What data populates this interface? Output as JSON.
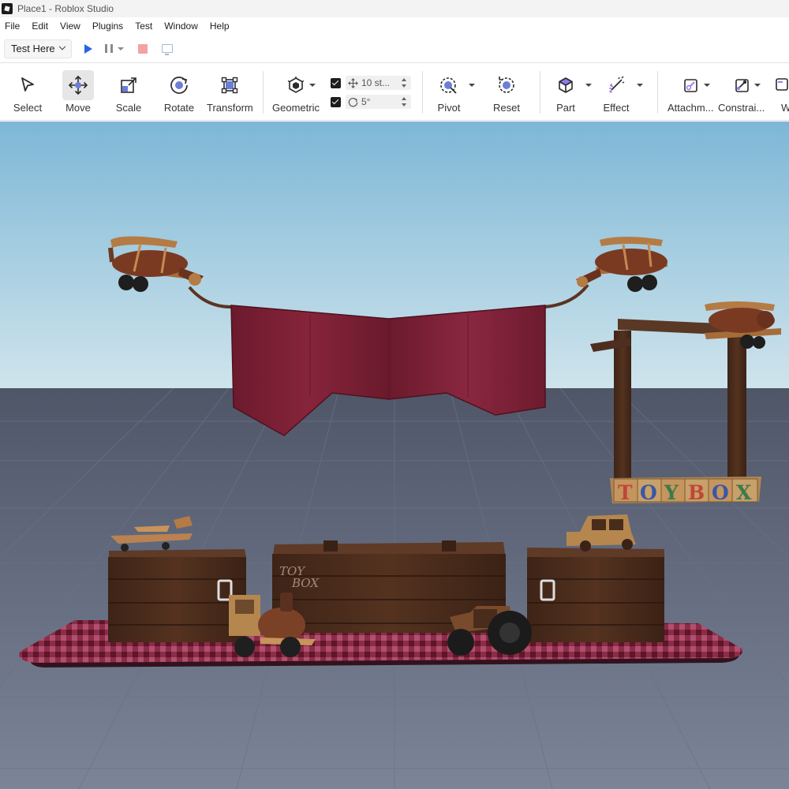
{
  "window": {
    "title": "Place1 - Roblox Studio"
  },
  "menu": [
    "File",
    "Edit",
    "View",
    "Plugins",
    "Test",
    "Window",
    "Help"
  ],
  "test_controls": {
    "mode_label": "Test Here"
  },
  "toolbar": {
    "tools": {
      "select": "Select",
      "move": "Move",
      "scale": "Scale",
      "rotate": "Rotate",
      "transform": "Transform",
      "geometric": "Geometric",
      "pivot": "Pivot",
      "reset": "Reset",
      "part": "Part",
      "effect": "Effect",
      "attachment": "Attachm...",
      "constraint": "Constrai...",
      "overflow": "W"
    },
    "snap": {
      "move_value": "10 st...",
      "rotate_value": "5°"
    },
    "active_tool": "move"
  },
  "scene": {
    "sign_letters": [
      "T",
      "O",
      "Y",
      "B",
      "O",
      "X"
    ],
    "chest_text_line1": "TOY",
    "chest_text_line2": "BOX",
    "colors": {
      "sky_top": "#7db7d6",
      "sky_horizon": "#cfe4ec",
      "ground": "#5c6477",
      "banner": "#7a1e33",
      "wood": "#4a2c1c",
      "rug": "#8c2c48"
    }
  }
}
